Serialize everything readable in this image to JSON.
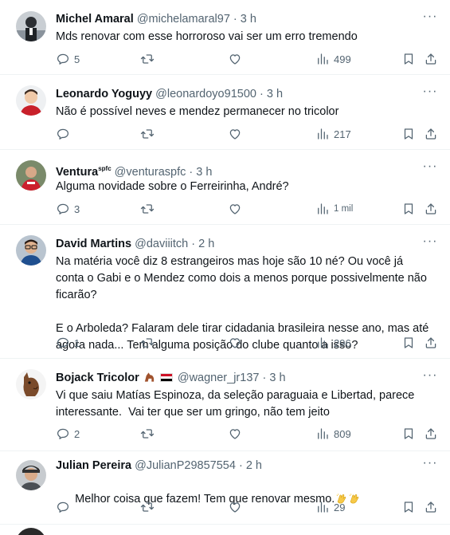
{
  "tweets": [
    {
      "name": "Michel Amaral",
      "handle": "@michelamaral97",
      "time": "3 h",
      "text": "Mds renovar com esse horroroso vai ser um erro tremendo",
      "replies": "5",
      "retweets": "",
      "likes": "",
      "views": "499"
    },
    {
      "name": "Leonardo Yoguyy",
      "handle": "@leonardoyo91500",
      "time": "3 h",
      "text": "Não é possível neves e mendez permanecer no tricolor",
      "replies": "",
      "retweets": "",
      "likes": "",
      "views": "217"
    },
    {
      "name": "Ventura",
      "name_sup": "spfc",
      "handle": "@venturaspfc",
      "time": "3 h",
      "text": "Alguma novidade sobre o Ferreirinha, André?",
      "replies": "3",
      "retweets": "",
      "likes": "",
      "views": "1 mil"
    },
    {
      "name": "David Martins",
      "handle": "@daviiitch",
      "time": "2 h",
      "text": "Na matéria você diz 8 estrangeiros mas hoje são 10 né? Ou você já conta o Gabi e o Mendez como dois a menos porque possivelmente não ficarão?\n\nE o Arboleda? Falaram dele tirar cidadania brasileira nesse ano, mas até agora nada... Tem alguma posição do clube quanto a isso?",
      "replies": "1",
      "retweets": "",
      "likes": "",
      "views": "296"
    },
    {
      "name": "Bojack Tricolor",
      "handle": "@wagner_jr137",
      "time": "3 h",
      "text": "Vi que saiu Matías Espinoza, da seleção paraguaia e Libertad, parece interessante.  Vai ter que ser um gringo, não tem jeito",
      "replies": "2",
      "retweets": "",
      "likes": "",
      "views": "809"
    },
    {
      "name": "Julian Pereira",
      "handle": "@JulianP29857554",
      "time": "2 h",
      "text": "Melhor coisa que fazem! Tem que renovar mesmo.",
      "replies": "",
      "retweets": "",
      "likes": "",
      "views": "29"
    }
  ],
  "separator": "·",
  "more_glyph": "···",
  "colors": {
    "text_primary": "#0f1419",
    "text_secondary": "#536471",
    "divider": "#eff3f4"
  },
  "icons": [
    "reply-icon",
    "retweet-icon",
    "like-icon",
    "views-icon",
    "bookmark-icon",
    "share-icon",
    "more-icon",
    "clap-emoji",
    "horse-emoji",
    "flag-emoji"
  ]
}
